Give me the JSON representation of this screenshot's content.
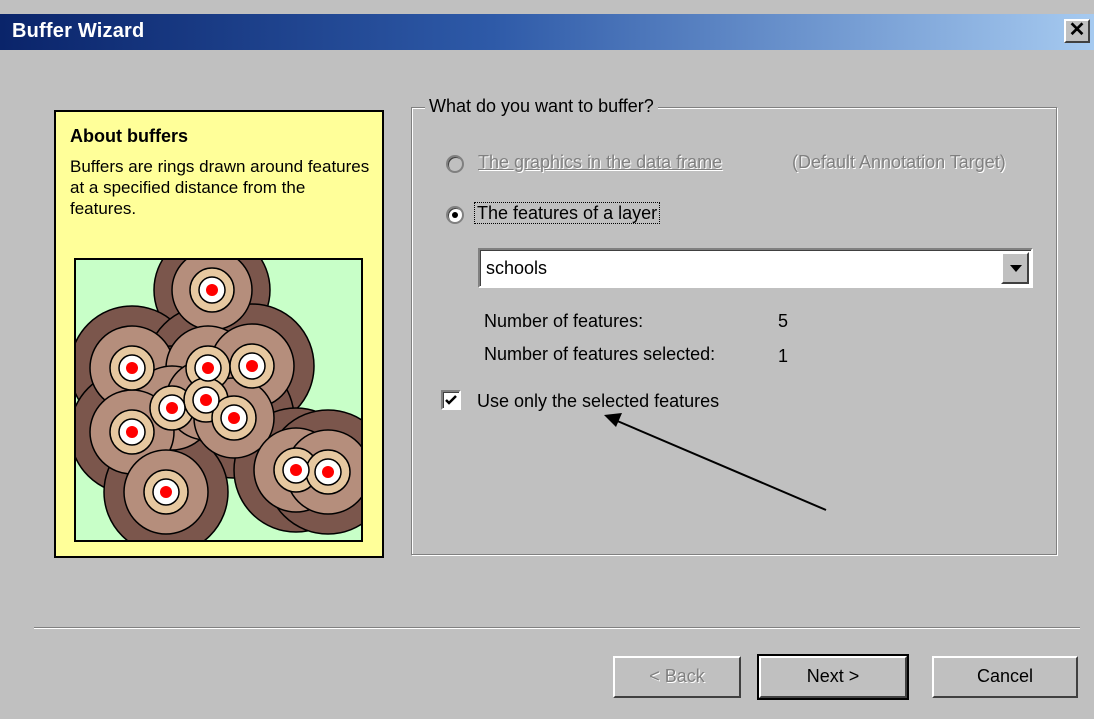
{
  "window": {
    "title": "Buffer Wizard",
    "close_glyph": "✕"
  },
  "about": {
    "title": "About buffers",
    "text": "Buffers are rings drawn around features at a specified distance from the features."
  },
  "group": {
    "legend": "What do you want to buffer?",
    "option_graphics": {
      "label": "The graphics in the data frame",
      "suffix": "(Default Annotation Target)",
      "enabled": false,
      "selected": false
    },
    "option_layer": {
      "label": "The features of a layer",
      "enabled": true,
      "selected": true
    },
    "layer_select": {
      "value": "schools"
    },
    "num_features_label": "Number of features:",
    "num_features_value": "5",
    "num_selected_label": "Number of features selected:",
    "num_selected_value": "1",
    "use_selected": {
      "label": "Use only the selected features",
      "checked": true
    }
  },
  "buttons": {
    "back": "< Back",
    "next": "Next >",
    "cancel": "Cancel"
  },
  "colors": {
    "title_gradient_start": "#0a246a",
    "panel_yellow": "#ffff99",
    "buffer_dark": "#7b564c",
    "buffer_mid": "#b58e7c",
    "buffer_light": "#e6c8a0",
    "feature_point": "#ff0000"
  }
}
